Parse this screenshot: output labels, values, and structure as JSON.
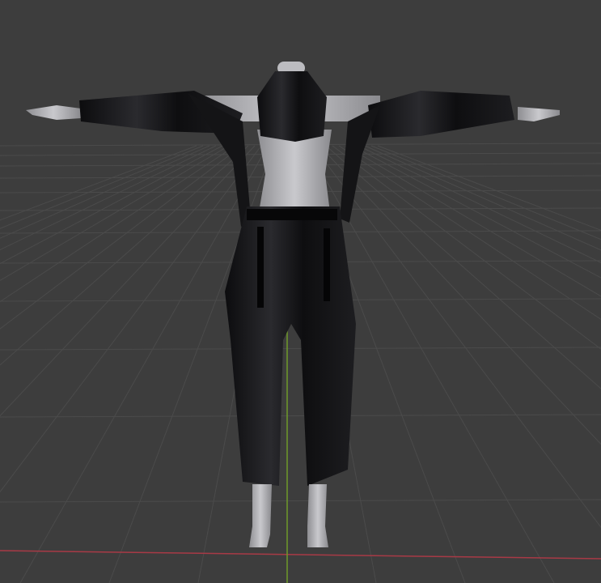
{
  "viewport": {
    "background_color": "#3d3d3d",
    "grid_color": "#4b4b4b",
    "x_axis_color": "#a83a46",
    "y_axis_color": "#6e9a2a",
    "model_skin_color": "#b9b9bd",
    "model_clothing_color": "#111113"
  }
}
